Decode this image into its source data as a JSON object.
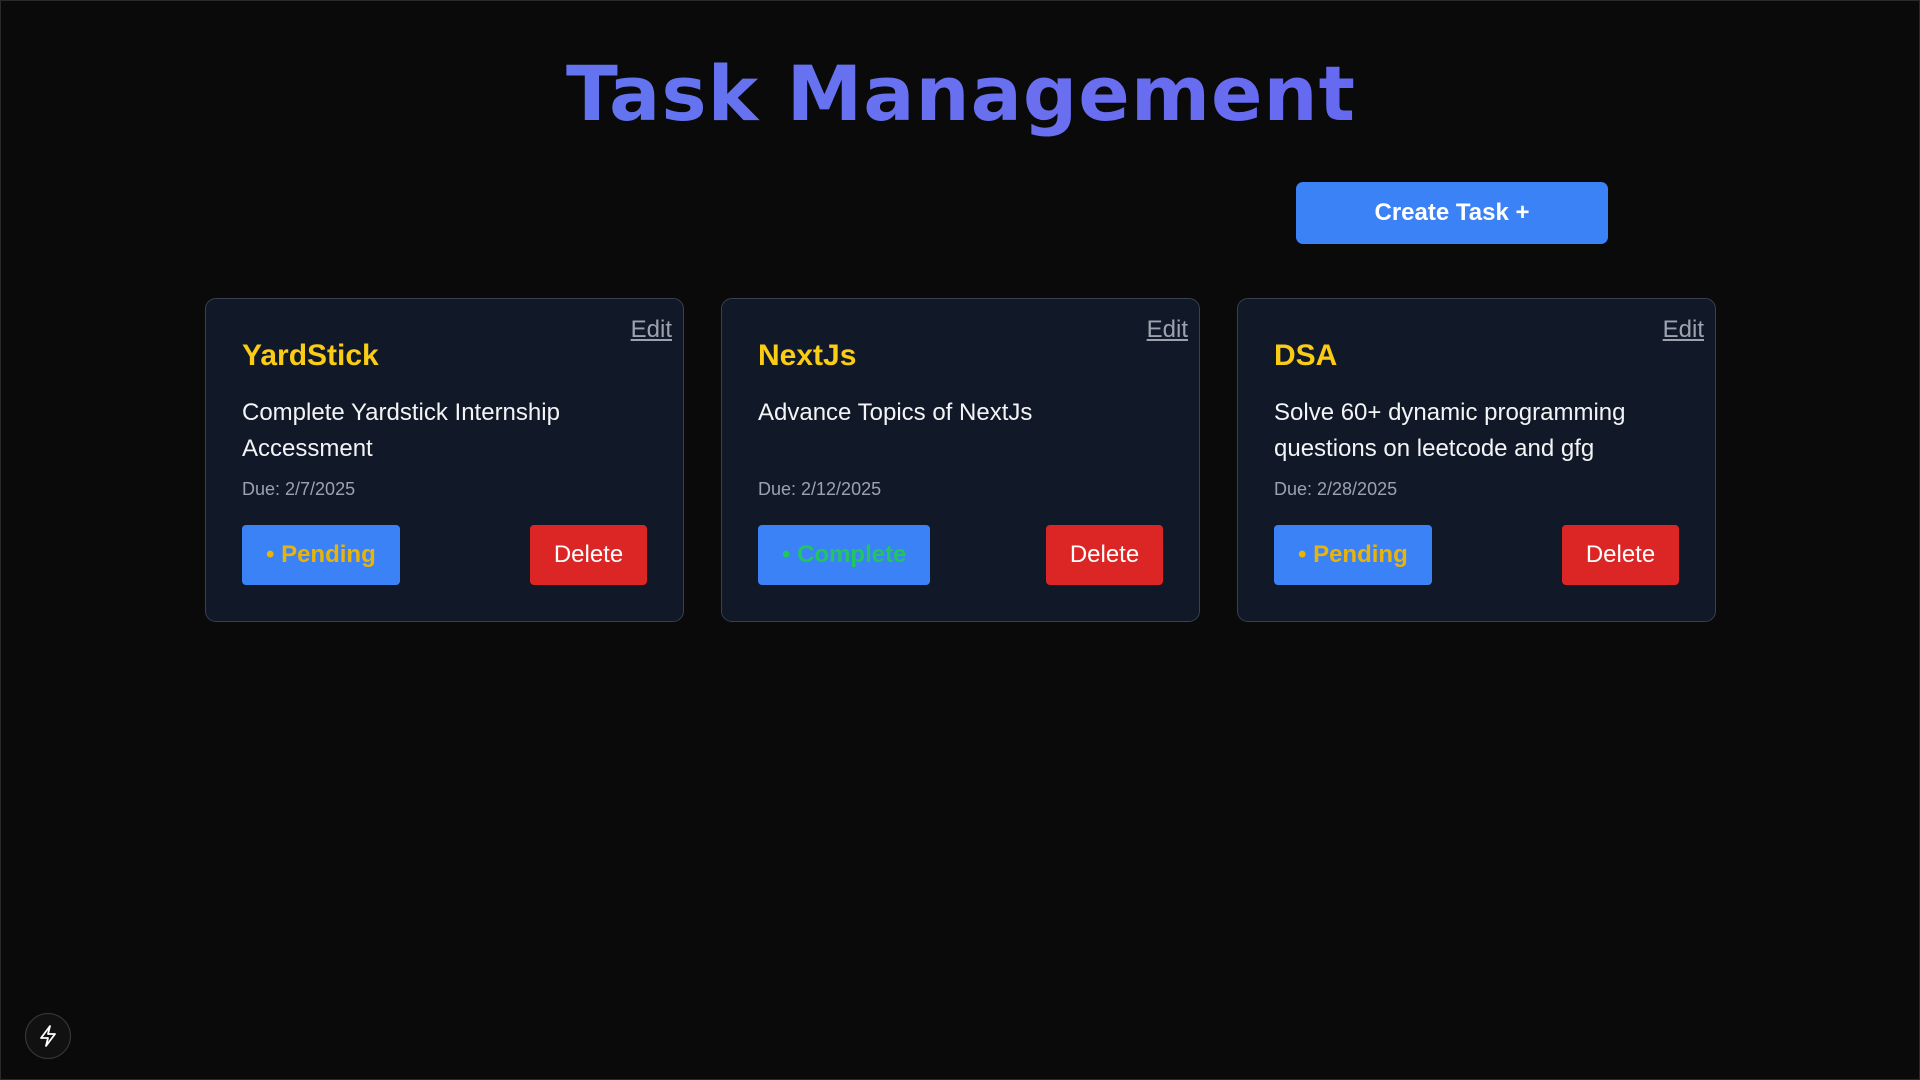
{
  "header": {
    "title": "Task Management"
  },
  "toolbar": {
    "create_label": "Create Task +"
  },
  "tasks": [
    {
      "title": "YardStick",
      "description": "Complete Yardstick Internship Accessment",
      "due": "Due: 2/7/2025",
      "status": "• Pending",
      "status_kind": "pending",
      "edit_label": "Edit",
      "delete_label": "Delete"
    },
    {
      "title": "NextJs",
      "description": "Advance Topics of NextJs",
      "due": "Due: 2/12/2025",
      "status": "• Complete",
      "status_kind": "complete",
      "edit_label": "Edit",
      "delete_label": "Delete"
    },
    {
      "title": "DSA",
      "description": "Solve 60+ dynamic programming questions on leetcode and gfg",
      "due": "Due: 2/28/2025",
      "status": "• Pending",
      "status_kind": "pending",
      "edit_label": "Edit",
      "delete_label": "Delete"
    }
  ],
  "colors": {
    "accent": "#3b82f6",
    "title_gradient": "#5b7bf0",
    "task_title": "#facc15",
    "pending": "#eab308",
    "complete": "#22c55e",
    "delete": "#dc2626",
    "card_bg": "#111827",
    "page_bg": "#0a0a0a"
  },
  "dev_badge": {
    "icon": "lightning-bolt-icon"
  }
}
